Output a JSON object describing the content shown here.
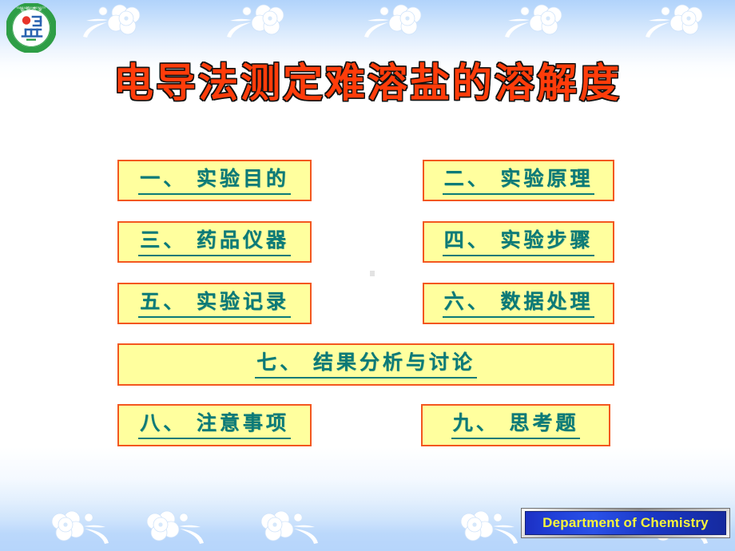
{
  "slide": {
    "title": "电导法测定难溶盐的溶解度",
    "background_top_color": "#b1d3fb",
    "background_mid_color": "#ffffff",
    "background_bottom_color": "#b6d5fb",
    "title_color": "#ff3c0a"
  },
  "logo": {
    "name": "yanbian-university-seal",
    "ring_color": "#2e9e46",
    "dot_color": "#e8342a",
    "mark_color": "#2a63b0",
    "top_text": "延 边 大 学",
    "bottom_text": "YANBIAN UNIVERSITY"
  },
  "menu": {
    "button_bg": "#ffff9e",
    "button_border": "#f3571f",
    "button_text_color": "#0c7a77",
    "items": [
      {
        "label": "一、 实验目的",
        "column": "left",
        "row": 1
      },
      {
        "label": "二、 实验原理",
        "column": "right",
        "row": 1
      },
      {
        "label": "三、 药品仪器",
        "column": "left",
        "row": 2
      },
      {
        "label": "四、 实验步骤",
        "column": "right",
        "row": 2
      },
      {
        "label": "五、 实验记录",
        "column": "left",
        "row": 3
      },
      {
        "label": "六、 数据处理",
        "column": "right",
        "row": 3
      },
      {
        "label": "七、 结果分析与讨论",
        "column": "wide",
        "row": 4
      },
      {
        "label": "八、 注意事项",
        "column": "left",
        "row": 5
      },
      {
        "label": "九、 思考题",
        "column": "right",
        "row": 5
      }
    ]
  },
  "footer": {
    "department_label": "Department of Chemistry",
    "text_color": "#f7f53c",
    "plate_color": "#2140d8"
  },
  "decor": {
    "flower_color": "#ffffff",
    "top_flower_count": 5,
    "bottom_flower_count": 5
  }
}
